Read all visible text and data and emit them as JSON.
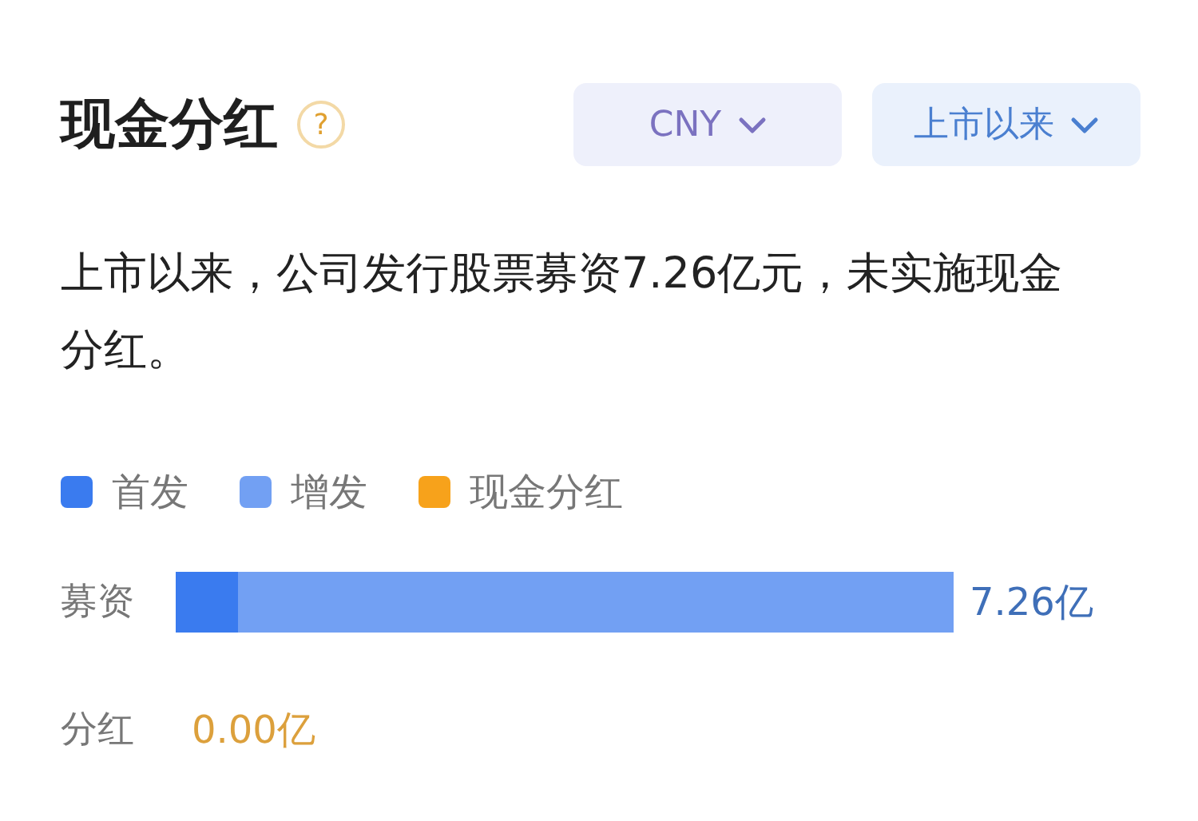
{
  "header": {
    "title": "现金分红",
    "help_icon": "?",
    "dropdowns": [
      {
        "label": "CNY",
        "kind": "currency"
      },
      {
        "label": "上市以来",
        "kind": "period"
      }
    ]
  },
  "summary": "上市以来，公司发行股票募资7.26亿元，未实施现金分红。",
  "legend": [
    {
      "label": "首发",
      "color": "#3a7bef"
    },
    {
      "label": "增发",
      "color": "#72a0f3"
    },
    {
      "label": "现金分红",
      "color": "#f7a21b"
    }
  ],
  "rows": [
    {
      "label": "募资",
      "value": "7.26亿",
      "segments": [
        {
          "color": "#3a7bef",
          "level": 0.08
        },
        {
          "color": "#72a0f3"
        }
      ]
    },
    {
      "label": "分红",
      "value": "0.00亿",
      "segments": []
    }
  ]
}
